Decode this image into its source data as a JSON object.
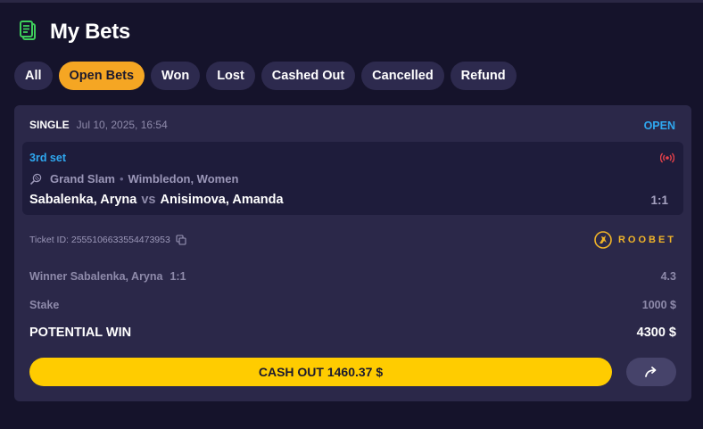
{
  "header": {
    "title": "My Bets",
    "icon": "bets-document-icon"
  },
  "tabs": [
    {
      "label": "All",
      "active": false
    },
    {
      "label": "Open Bets",
      "active": true
    },
    {
      "label": "Won",
      "active": false
    },
    {
      "label": "Lost",
      "active": false
    },
    {
      "label": "Cashed Out",
      "active": false
    },
    {
      "label": "Cancelled",
      "active": false
    },
    {
      "label": "Refund",
      "active": false
    }
  ],
  "bet": {
    "type": "SINGLE",
    "date": "Jul 10, 2025, 16:54",
    "status": "OPEN",
    "event": {
      "period": "3rd set",
      "category": "Grand Slam",
      "tournament": "Wimbledon, Women",
      "home": "Sabalenka, Aryna",
      "vs": "vs",
      "away": "Anisimova, Amanda",
      "score": "1:1"
    },
    "ticket_label": "Ticket ID:",
    "ticket_id": "2555106633554473953",
    "brand": "ROOBET",
    "selection": "Winner Sabalenka, Aryna",
    "selection_score": "1:1",
    "odds": "4.3",
    "stake_label": "Stake",
    "stake": "1000 $",
    "potential_label": "POTENTIAL WIN",
    "potential": "4300 $",
    "cashout_label": "CASH OUT 1460.37 $"
  },
  "colors": {
    "background": "#15132b",
    "card": "#2b2849",
    "accent_tab": "#f5a623",
    "cashout": "#ffcc00",
    "status_blue": "#2fa8f0",
    "live_red": "#e8424a",
    "brand_gold": "#f0b429"
  }
}
